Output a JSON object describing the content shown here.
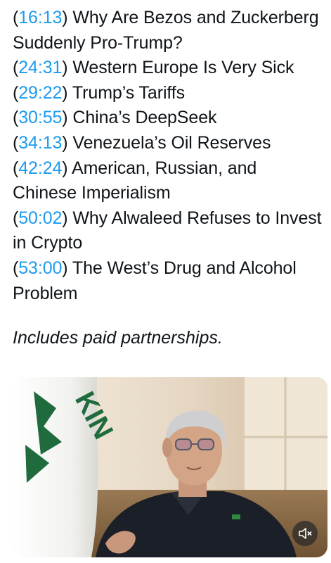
{
  "post": {
    "chapters": [
      {
        "time": "16:13",
        "title": "Why Are Bezos and Zuckerberg Suddenly Pro-Trump?"
      },
      {
        "time": "24:31",
        "title": "Western Europe Is Very Sick"
      },
      {
        "time": "29:22",
        "title": "Trump’s Tariffs"
      },
      {
        "time": "30:55",
        "title": "China’s DeepSeek"
      },
      {
        "time": "34:13",
        "title": "Venezuela’s Oil Reserves"
      },
      {
        "time": "42:24",
        "title": "American, Russian, and Chinese Imperialism"
      },
      {
        "time": "50:02",
        "title": "Why Alwaleed Refuses to Invest in Crypto"
      },
      {
        "time": "53:00",
        "title": "The West’s Drug and Alcohol Problem"
      }
    ],
    "disclosure": "Includes paid partnerships."
  },
  "media": {
    "flag_text": "KIN",
    "mute_icon": "speaker-muted-icon"
  },
  "colors": {
    "timestamp_link": "#1d9bf0",
    "text": "#0f1419",
    "background": "#ffffff"
  }
}
